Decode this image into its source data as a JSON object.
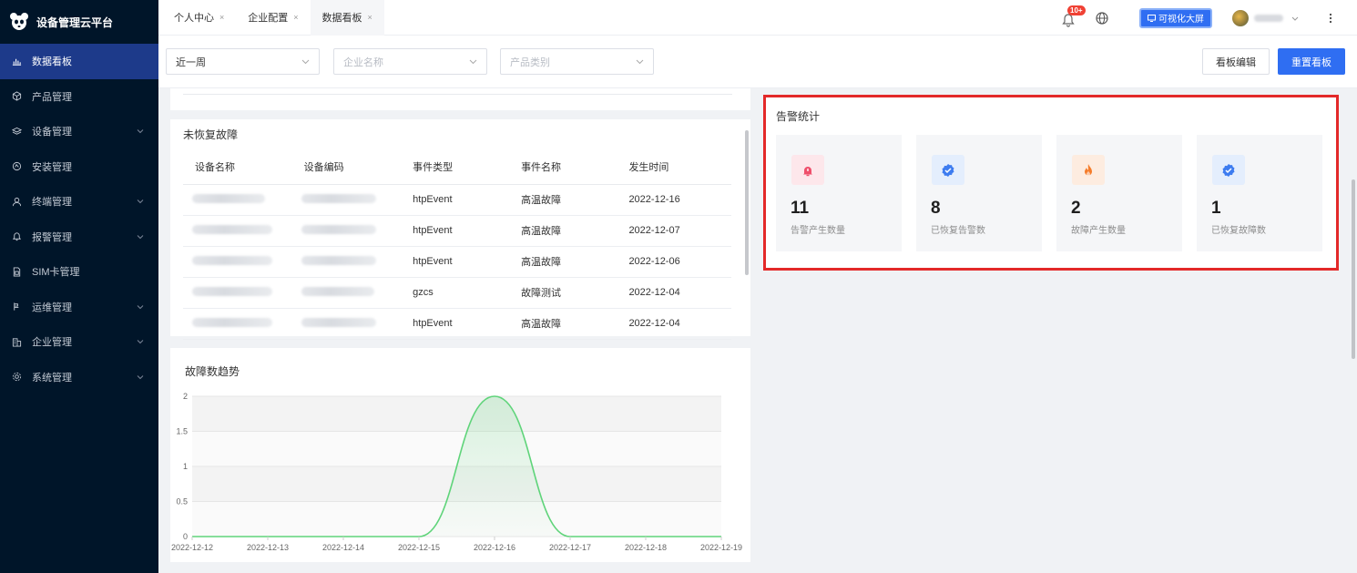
{
  "sidebar": {
    "title": "设备管理云平台",
    "items": [
      {
        "label": "数据看板",
        "icon": "chart-icon",
        "active": true
      },
      {
        "label": "产品管理",
        "icon": "cube-icon"
      },
      {
        "label": "设备管理",
        "icon": "layers-icon",
        "expand": true
      },
      {
        "label": "安装管理",
        "icon": "tool-icon"
      },
      {
        "label": "终端管理",
        "icon": "user-icon",
        "expand": true
      },
      {
        "label": "报警管理",
        "icon": "alarm-icon",
        "expand": true
      },
      {
        "label": "SIM卡管理",
        "icon": "sim-icon"
      },
      {
        "label": "运维管理",
        "icon": "wrench-icon",
        "expand": true
      },
      {
        "label": "企业管理",
        "icon": "building-icon",
        "expand": true
      },
      {
        "label": "系统管理",
        "icon": "gear-icon",
        "expand": true
      }
    ]
  },
  "tabs": [
    {
      "label": "个人中心"
    },
    {
      "label": "企业配置"
    },
    {
      "label": "数据看板",
      "active": true
    }
  ],
  "header": {
    "notification_count": "10+",
    "bigscreen_label": "可视化大屏"
  },
  "filters": {
    "period": "近一周",
    "company_placeholder": "企业名称",
    "category_placeholder": "产品类别",
    "edit_label": "看板编辑",
    "reset_label": "重置看板"
  },
  "faults": {
    "title": "未恢复故障",
    "columns": [
      "设备名称",
      "设备编码",
      "事件类型",
      "事件名称",
      "发生时间"
    ],
    "rows": [
      {
        "type": "htpEvent",
        "name": "高温故障",
        "time": "2022-12-16"
      },
      {
        "type": "htpEvent",
        "name": "高温故障",
        "time": "2022-12-07"
      },
      {
        "type": "htpEvent",
        "name": "高温故障",
        "time": "2022-12-06"
      },
      {
        "type": "gzcs",
        "name": "故障测试",
        "time": "2022-12-04"
      },
      {
        "type": "htpEvent",
        "name": "高温故障",
        "time": "2022-12-04"
      }
    ]
  },
  "alarm_stats": {
    "title": "告警统计",
    "cards": [
      {
        "value": "11",
        "label": "告警产生数量",
        "icon": "alarm-bell-icon",
        "color": "#ef4f6b",
        "bg": "#fde7eb"
      },
      {
        "value": "8",
        "label": "已恢复告警数",
        "icon": "verified-badge-icon",
        "color": "#3d7cf0",
        "bg": "#e4eefd"
      },
      {
        "value": "2",
        "label": "故障产生数量",
        "icon": "fire-icon",
        "color": "#f57c2a",
        "bg": "#fdece0"
      },
      {
        "value": "1",
        "label": "已恢复故障数",
        "icon": "verified-badge-icon",
        "color": "#3d7cf0",
        "bg": "#e4eefd"
      }
    ]
  },
  "trend": {
    "title": "故障数趋势"
  },
  "chart_data": {
    "type": "area",
    "title": "故障数趋势",
    "x": [
      "2022-12-12",
      "2022-12-13",
      "2022-12-14",
      "2022-12-15",
      "2022-12-16",
      "2022-12-17",
      "2022-12-18",
      "2022-12-19"
    ],
    "y": [
      0,
      0,
      0,
      0,
      2,
      0,
      0,
      0
    ],
    "yticks": [
      "0",
      "0.5",
      "1",
      "1.5",
      "2"
    ],
    "ylim": [
      0,
      2
    ],
    "smooth": true,
    "line_color": "#5fd47a",
    "grid": "alternating-bands"
  }
}
